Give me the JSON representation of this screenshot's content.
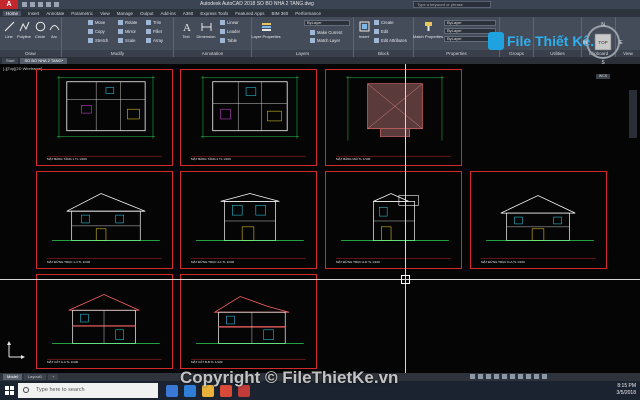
{
  "window": {
    "title": "Autodesk AutoCAD 2018   SO BO NHA 2 TANG.dwg",
    "search_placeholder": "Type a keyword or phrase"
  },
  "ribbon_tabs": [
    "Home",
    "Insert",
    "Annotate",
    "Parametric",
    "View",
    "Manage",
    "Output",
    "Add-ins",
    "A360",
    "Express Tools",
    "Featured Apps",
    "BIM 360",
    "Performance"
  ],
  "ribbon": {
    "draw": {
      "title": "Draw",
      "line": "Line",
      "polyline": "Polyline",
      "circle": "Circle",
      "arc": "Arc"
    },
    "modify": {
      "title": "Modify",
      "move": "Move",
      "rotate": "Rotate",
      "trim": "Trim",
      "copy": "Copy",
      "mirror": "Mirror",
      "fillet": "Fillet",
      "stretch": "Stretch",
      "scale": "Scale",
      "array": "Array"
    },
    "annotation": {
      "title": "Annotation",
      "text": "Text",
      "dimension": "Dimension",
      "linear": "Linear",
      "leader": "Leader",
      "table": "Table"
    },
    "layers": {
      "title": "Layers",
      "layer_properties": "Layer Properties",
      "make_current": "Make Current",
      "match_layer": "Match Layer"
    },
    "block": {
      "title": "Block",
      "insert": "Insert",
      "create": "Create",
      "edit": "Edit",
      "edit_attributes": "Edit Attributes"
    },
    "properties": {
      "title": "Properties",
      "match_properties": "Match Properties",
      "bylayer": "ByLayer"
    },
    "groups": {
      "title": "Groups"
    },
    "utilities": {
      "title": "Utilities"
    },
    "clipboard": {
      "title": "Clipboard"
    },
    "view": {
      "title": "View"
    }
  },
  "brand_logo_text": "File Thiết Kế.vn",
  "doc_tabs": [
    "Start",
    "SO BO NHA 2 TANG*"
  ],
  "viewport_label": "[-][Top][2D Wireframe]",
  "sheets": [
    {
      "title": "MẶT BẰNG TẦNG 1  TL 1/100"
    },
    {
      "title": "MẶT BẰNG TẦNG 2  TL 1/100"
    },
    {
      "title": "MẶT BẰNG MÁI  TL 1/100"
    },
    {
      "title": "MẶT ĐỨNG TRỤC 1-4  TL 1/100"
    },
    {
      "title": "MẶT ĐỨNG TRỤC 4-1  TL 1/100"
    },
    {
      "title": "MẶT ĐỨNG TRỤC A-D  TL 1/100"
    },
    {
      "title": "MẶT ĐỨNG TRỤC D-A  TL 1/100"
    },
    {
      "title": "MẶT CẮT A-A  TL 1/100"
    },
    {
      "title": "MẶT CẮT B-B  TL 1/100"
    }
  ],
  "viewcube": {
    "top": "TOP",
    "n": "N",
    "s": "S",
    "e": "E",
    "w": "W",
    "wcs": "WCS"
  },
  "layout_tabs": [
    "Model",
    "Layout1",
    "+"
  ],
  "taskbar": {
    "search_placeholder": "Type here to search"
  },
  "tray": {
    "time": "8:15 PM",
    "date": "3/5/2018"
  },
  "watermark": "Copyright © FileThietKe.vn"
}
